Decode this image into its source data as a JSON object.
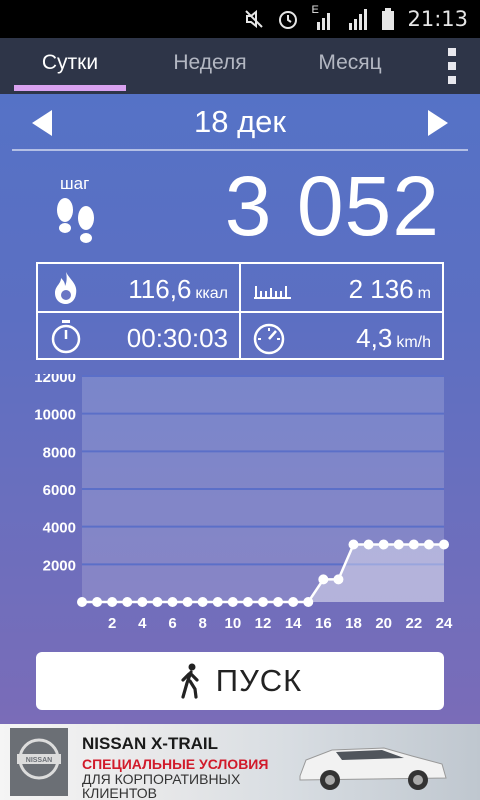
{
  "status_bar": {
    "time": "21:13",
    "network_label": "E",
    "icons": [
      "muted-icon",
      "alarm-icon",
      "signal-e-icon",
      "signal-icon",
      "battery-icon"
    ]
  },
  "tabs": [
    {
      "label": "Сутки",
      "active": true
    },
    {
      "label": "Неделя",
      "active": false
    },
    {
      "label": "Месяц",
      "active": false
    }
  ],
  "date": {
    "label": "18 дек"
  },
  "steps": {
    "unit": "шаг",
    "value": "3 052"
  },
  "stats": {
    "calories": {
      "value": "116,6",
      "unit": "ккал"
    },
    "distance": {
      "value": "2 136",
      "unit": "m"
    },
    "duration": {
      "value": "00:30:03"
    },
    "speed": {
      "value": "4,3",
      "unit": "km/h"
    }
  },
  "chart_data": {
    "type": "area",
    "y_ticks": [
      2000,
      4000,
      6000,
      8000,
      10000,
      12000
    ],
    "x_tick_labels": [
      "2",
      "4",
      "6",
      "8",
      "10",
      "12",
      "14",
      "16",
      "18",
      "20",
      "22",
      "24"
    ],
    "ylim": [
      0,
      12000
    ],
    "xlim": [
      0,
      24
    ],
    "x": [
      0,
      1,
      2,
      3,
      4,
      5,
      6,
      7,
      8,
      9,
      10,
      11,
      12,
      13,
      14,
      15,
      16,
      17,
      18,
      19,
      20,
      21,
      22,
      23,
      24
    ],
    "values": [
      0,
      0,
      0,
      0,
      0,
      0,
      0,
      0,
      0,
      0,
      0,
      0,
      0,
      0,
      0,
      0,
      1200,
      1200,
      3052,
      3052,
      3052,
      3052,
      3052,
      3052,
      3052
    ]
  },
  "start_button": {
    "label": "ПУСК"
  },
  "ad": {
    "brand": "NISSAN",
    "title": "NISSAN X-TRAIL",
    "line1": "СПЕЦИАЛЬНЫЕ УСЛОВИЯ",
    "line2": "ДЛЯ КОРПОРАТИВНЫХ",
    "line3": "КЛИЕНТОВ"
  },
  "colors": {
    "accent_underline": "#d9a2f0",
    "tabbar_bg": "#2e3548",
    "panel_top": "#5572c6",
    "panel_bottom": "#7a6cb8"
  }
}
